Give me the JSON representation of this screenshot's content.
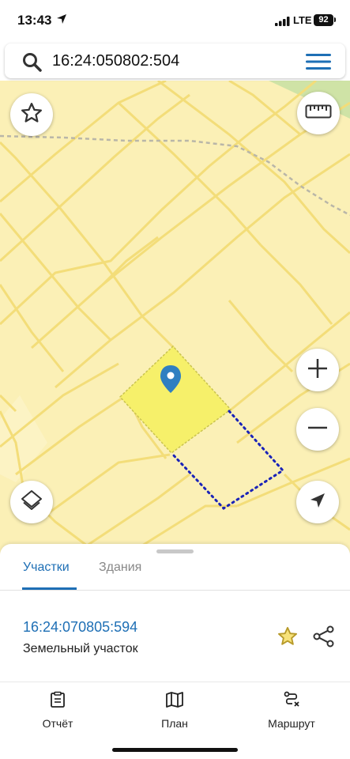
{
  "status": {
    "time": "13:43",
    "network": "LTE",
    "battery": "92"
  },
  "search": {
    "query": "16:24:050802:504"
  },
  "icons": {
    "search": "search-icon",
    "menu": "menu-icon",
    "favorite": "star-icon",
    "ruler": "ruler-icon",
    "zoom_in": "plus-icon",
    "zoom_out": "minus-icon",
    "layers": "layers-icon",
    "locate": "navigation-arrow-icon",
    "marker": "map-pin-icon",
    "share": "share-icon",
    "report": "report-icon",
    "plan": "map-icon",
    "route": "route-icon"
  },
  "colors": {
    "accent": "#1e6fb5",
    "map_background": "#fbf0b6",
    "parcel_lines": "#f3dd79",
    "selected_parcel": "#f6f06a",
    "boundary_dots": "#1a23b8"
  },
  "sheet": {
    "tabs": [
      {
        "label": "Участки",
        "active": true
      },
      {
        "label": "Здания",
        "active": false
      }
    ],
    "parcel": {
      "cadastral_number": "16:24:070805:594",
      "type": "Земельный участок"
    }
  },
  "bottom_nav": {
    "items": [
      {
        "label": "Отчёт",
        "icon": "report-icon"
      },
      {
        "label": "План",
        "icon": "map-icon"
      },
      {
        "label": "Маршрут",
        "icon": "route-icon"
      }
    ]
  }
}
